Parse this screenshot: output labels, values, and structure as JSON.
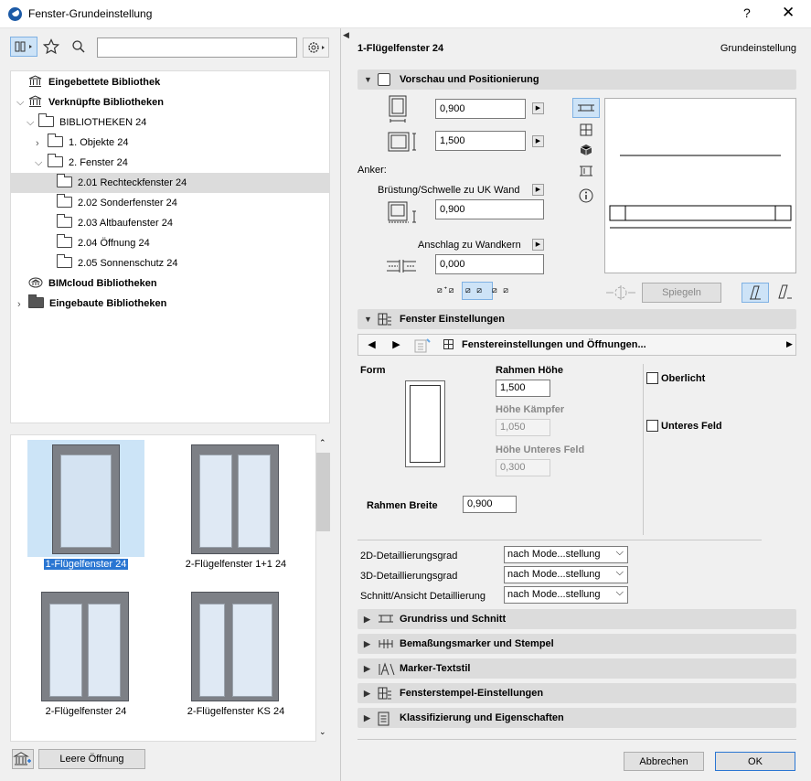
{
  "window": {
    "title": "Fenster-Grundeinstellung",
    "help": "?",
    "close": "✕"
  },
  "search": {
    "value": "",
    "placeholder": ""
  },
  "tree": {
    "items": [
      {
        "label": "Eingebettete Bibliothek",
        "bold": true
      },
      {
        "label": "Verknüpfte Bibliotheken",
        "bold": true
      },
      {
        "label": "BIBLIOTHEKEN 24"
      },
      {
        "label": "1. Objekte 24"
      },
      {
        "label": "2. Fenster 24"
      },
      {
        "label": "2.01 Rechteckfenster 24",
        "selected": true
      },
      {
        "label": "2.02 Sonderfenster 24"
      },
      {
        "label": "2.03 Altbaufenster 24"
      },
      {
        "label": "2.04 Öffnung 24"
      },
      {
        "label": "2.05 Sonnenschutz 24"
      },
      {
        "label": "BIMcloud Bibliotheken",
        "bold": true
      },
      {
        "label": "Eingebaute Bibliotheken",
        "bold": true
      }
    ]
  },
  "previews": [
    {
      "label": "1-Flügelfenster 24",
      "selected": true
    },
    {
      "label": "2-Flügelfenster 1+1 24"
    },
    {
      "label": "2-Flügelfenster 24"
    },
    {
      "label": "2-Flügelfenster KS 24"
    }
  ],
  "bottom_left": {
    "empty_opening": "Leere Öffnung"
  },
  "header": {
    "element": "1-Flügelfenster 24",
    "mode": "Grundeinstellung"
  },
  "preview_section": {
    "title": "Vorschau und Positionierung",
    "width": "0,900",
    "height": "1,500",
    "anchor_label": "Anker:",
    "sill_label": "Brüstung/Schwelle zu UK Wand",
    "sill_value": "0,900",
    "reveal_label": "Anschlag zu Wandkern",
    "reveal_value": "0,000",
    "mirror": "Spiegeln"
  },
  "window_settings": {
    "title": "Fenster Einstellungen",
    "page": "Fenstereinstellungen und Öffnungen...",
    "form_label": "Form",
    "frame_height_label": "Rahmen Höhe",
    "frame_height": "1,500",
    "transom_height_label": "Höhe Kämpfer",
    "transom_height": "1,050",
    "lower_field_height_label": "Höhe Unteres Feld",
    "lower_field_height": "0,300",
    "frame_width_label": "Rahmen Breite",
    "frame_width": "0,900",
    "skylight": "Oberlicht",
    "lower_field": "Unteres Feld",
    "detail_2d_label": "2D-Detaillierungsgrad",
    "detail_2d": "nach Mode...stellung",
    "detail_3d_label": "3D-Detaillierungsgrad",
    "detail_3d": "nach Mode...stellung",
    "detail_section_label": "Schnitt/Ansicht Detaillierung",
    "detail_section": "nach Mode...stellung"
  },
  "sections": [
    "Grundriss und Schnitt",
    "Bemaßungsmarker und Stempel",
    "Marker-Textstil",
    "Fensterstempel-Einstellungen",
    "Klassifizierung und Eigenschaften"
  ],
  "footer": {
    "cancel": "Abbrechen",
    "ok": "OK"
  }
}
